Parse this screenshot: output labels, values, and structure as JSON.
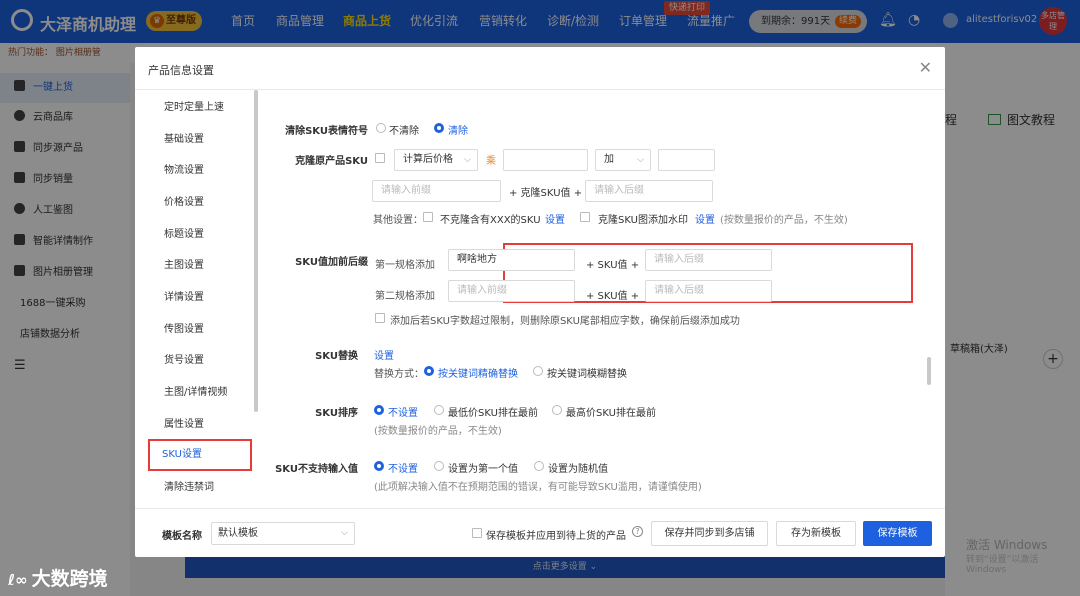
{
  "topbar": {
    "app_name": "大泽商机助理",
    "edition": "至尊版",
    "nav": [
      "首页",
      "商品管理",
      "商品上货",
      "优化引流",
      "营销转化",
      "诊断/检测",
      "订单管理",
      "流量推广"
    ],
    "active_nav": "商品上货",
    "nav_badge": "快递打印",
    "expire_text": "到期余：991天",
    "renew_label": "续费",
    "account": "alitestforisv02",
    "shop_avatar": "多店管理"
  },
  "subbar": {
    "text": "热门功能：   图片相册管"
  },
  "sidebar": {
    "items": [
      "一键上货",
      "云商品库",
      "同步源产品",
      "同步销量",
      "人工鉴图",
      "智能详情制作",
      "图片相册管理",
      "1688一键采购",
      "店铺数据分析"
    ],
    "active": "一键上货"
  },
  "background": {
    "tutorial": "图文教程",
    "tutorial_prefix": "程",
    "caotai": "草稿箱(大泽)",
    "more_settings": "点击更多设置",
    "win_watermark": "激活 Windows",
    "win_watermark_sub": "转到“设置”以激活 Windows",
    "brand_watermark": "大数跨境"
  },
  "modal": {
    "title": "产品信息设置",
    "menu": [
      "定时定量上速",
      "基础设置",
      "物流设置",
      "价格设置",
      "标题设置",
      "主图设置",
      "详情设置",
      "传图设置",
      "货号设置",
      "主图/详情视频",
      "属性设置",
      "SKU设置",
      "清除违禁词"
    ],
    "active_menu": "SKU设置",
    "form": {
      "clear_emoji": {
        "label": "清除SKU表情符号",
        "options": [
          "不清除",
          "清除"
        ],
        "selected": "清除"
      },
      "clone_sku": {
        "label": "克隆原产品SKU",
        "calc_select": "计算后价格",
        "multiply": "乘",
        "op_select": "加",
        "prefix_placeholder": "请输入前缀",
        "plus_clone": "+ 克隆SKU值 +",
        "suffix_placeholder": "请输入后缀",
        "other_label": "其他设置：",
        "no_clone_xxx": "不克隆含有XXX的SKU",
        "settings_link": "设置",
        "watermark_opt": "克隆SKU图添加水印",
        "watermark_note": "(按数量报价的产品，不生效)"
      },
      "sku_affix": {
        "label": "SKU值加前后缀",
        "spec1_label": "第一规格添加",
        "spec1_value": "啊啥地方",
        "spec2_label": "第二规格添加",
        "prefix_placeholder": "请输入前缀",
        "plus_sku": "+ SKU值 +",
        "suffix_placeholder": "请输入后缀",
        "truncate_note": "添加后若SKU字数超过限制，则删除原SKU尾部相应字数，确保前后缀添加成功"
      },
      "sku_replace": {
        "label": "SKU替换",
        "settings_link": "设置",
        "mode_label": "替换方式：",
        "options": [
          "按关键词精确替换",
          "按关键词模糊替换"
        ],
        "selected": "按关键词精确替换"
      },
      "sku_sort": {
        "label": "SKU排序",
        "options": [
          "不设置",
          "最低价SKU排在最前",
          "最高价SKU排在最前"
        ],
        "selected": "不设置",
        "note": "(按数量报价的产品，不生效)"
      },
      "sku_unsupported": {
        "label": "SKU不支持输入值",
        "options": [
          "不设置",
          "设置为第一个值",
          "设置为随机值"
        ],
        "selected": "不设置",
        "note": "(此项解决输入值不在预期范围的错误，有可能导致SKU滥用，请谨慎使用)"
      }
    },
    "footer": {
      "template_label": "模板名称",
      "template_value": "默认模板",
      "save_apply": "保存模板并应用到待上货的产品",
      "btn_sync": "保存并同步到多店铺",
      "btn_new": "存为新模板",
      "btn_save": "保存模板"
    }
  },
  "colors": {
    "primary": "#1d61e0",
    "highlight": "#e43c3c",
    "accent_yellow": "#ffe000"
  }
}
